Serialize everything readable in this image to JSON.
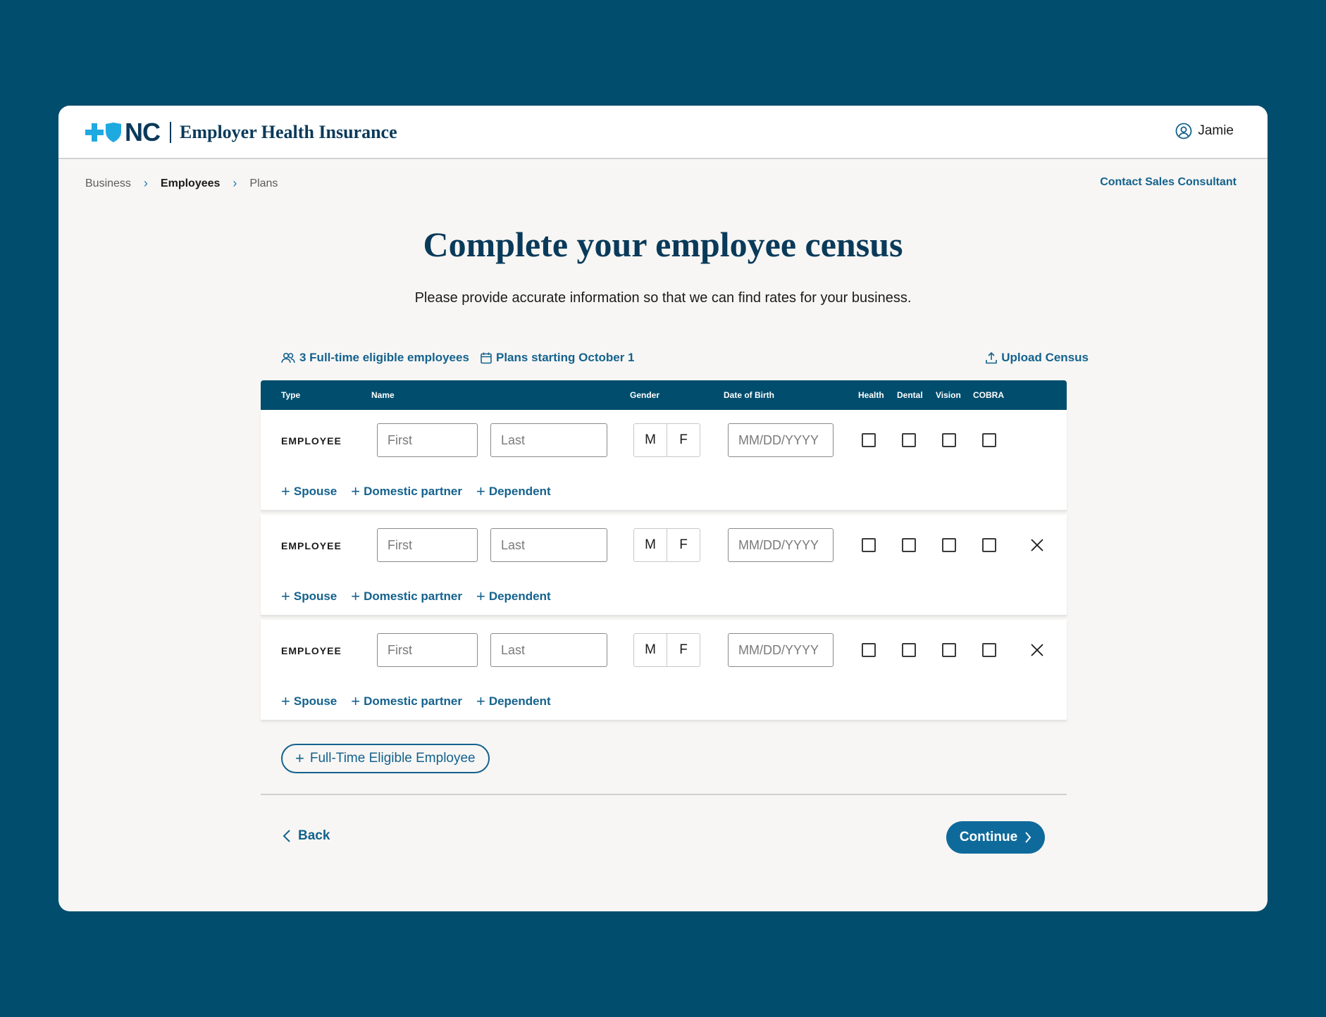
{
  "brand": {
    "logo_text": "NC",
    "title": "Employer Health Insurance"
  },
  "user": {
    "name": "Jamie"
  },
  "breadcrumb": [
    {
      "label": "Business"
    },
    {
      "label": "Employees"
    },
    {
      "label": "Plans"
    }
  ],
  "contact_label": "Contact Sales Consultant",
  "page": {
    "title": "Complete your employee census",
    "subtitle": "Please provide accurate information so that we can find rates for your business."
  },
  "meta": {
    "employees_label": "3 Full-time eligible employees",
    "plans_label": "Plans starting October 1",
    "upload_label": "Upload Census"
  },
  "table": {
    "headers": {
      "type": "Type",
      "name": "Name",
      "gender": "Gender",
      "dob": "Date of Birth",
      "health": "Health",
      "dental": "Dental",
      "vision": "Vision",
      "cobra": "COBRA"
    },
    "rows": [
      {
        "type": "EMPLOYEE",
        "first_placeholder": "First",
        "last_placeholder": "Last",
        "gender_m": "M",
        "gender_f": "F",
        "dob_placeholder": "MM/DD/YYYY",
        "removable": false
      },
      {
        "type": "EMPLOYEE",
        "first_placeholder": "First",
        "last_placeholder": "Last",
        "gender_m": "M",
        "gender_f": "F",
        "dob_placeholder": "MM/DD/YYYY",
        "removable": true
      },
      {
        "type": "EMPLOYEE",
        "first_placeholder": "First",
        "last_placeholder": "Last",
        "gender_m": "M",
        "gender_f": "F",
        "dob_placeholder": "MM/DD/YYYY",
        "removable": true
      }
    ],
    "row_actions": {
      "spouse": "Spouse",
      "partner": "Domestic partner",
      "dependent": "Dependent"
    }
  },
  "add_employee_label": "Full-Time Eligible Employee",
  "nav": {
    "back_label": "Back",
    "continue_label": "Continue"
  },
  "colors": {
    "page_bg": "#014d6d",
    "accent": "#14628e",
    "header_bar": "#014d6d",
    "continue_bg": "#0f6a9c",
    "logo_blue": "#1fa9e1"
  }
}
